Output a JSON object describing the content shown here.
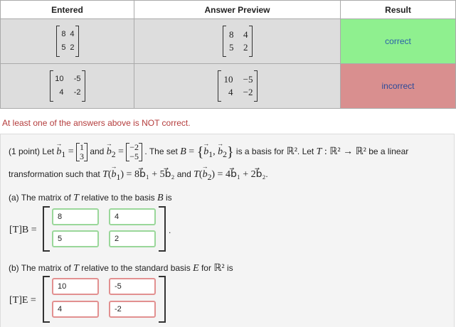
{
  "results_table": {
    "headers": [
      "Entered",
      "Answer Preview",
      "Result"
    ],
    "rows": [
      {
        "entered": [
          [
            "8",
            "4"
          ],
          [
            "5",
            "2"
          ]
        ],
        "preview": [
          [
            "8",
            "4"
          ],
          [
            "5",
            "2"
          ]
        ],
        "result": "correct",
        "result_color": "#8ff08f"
      },
      {
        "entered": [
          [
            "10",
            "-5"
          ],
          [
            "4",
            "-2"
          ]
        ],
        "preview": [
          [
            "10",
            "−5"
          ],
          [
            "4",
            "−2"
          ]
        ],
        "result": "incorrect",
        "result_color": "#d98f8f"
      }
    ]
  },
  "warning": "At least one of the answers above is NOT correct.",
  "problem": {
    "intro_prefix": "(1 point) Let",
    "b1_symbol": "b",
    "b1_sub": "1",
    "b1_vector": [
      "1",
      "3"
    ],
    "and_text": "and",
    "b2_symbol": "b",
    "b2_sub": "2",
    "b2_vector": [
      "−2",
      "−5"
    ],
    "set_text": ". The set",
    "set_name": "B",
    "basis_text": "is a basis for",
    "space": "ℝ²",
    "let_text": ". Let",
    "map_name": "T",
    "map_text": "be a linear",
    "line2_text": "transformation such that",
    "tb1_rhs": "8b⃗₁ + 5b⃗₂",
    "tb2_rhs": "4b⃗₁ + 2b⃗₂",
    "part_a": {
      "prefix": "(a) The matrix of",
      "middle": "relative to the basis",
      "basis": "B",
      "suffix": "is",
      "label": "[T]B =",
      "values": [
        [
          "8",
          "4"
        ],
        [
          "5",
          "2"
        ]
      ],
      "status": "correct"
    },
    "part_b": {
      "prefix": "(b) The matrix of",
      "middle": "relative to the standard basis",
      "basis": "E",
      "for_text": "for",
      "suffix": "is",
      "label": "[T]E =",
      "values": [
        [
          "10",
          "-5"
        ],
        [
          "4",
          "-2"
        ]
      ],
      "status": "incorrect"
    }
  }
}
